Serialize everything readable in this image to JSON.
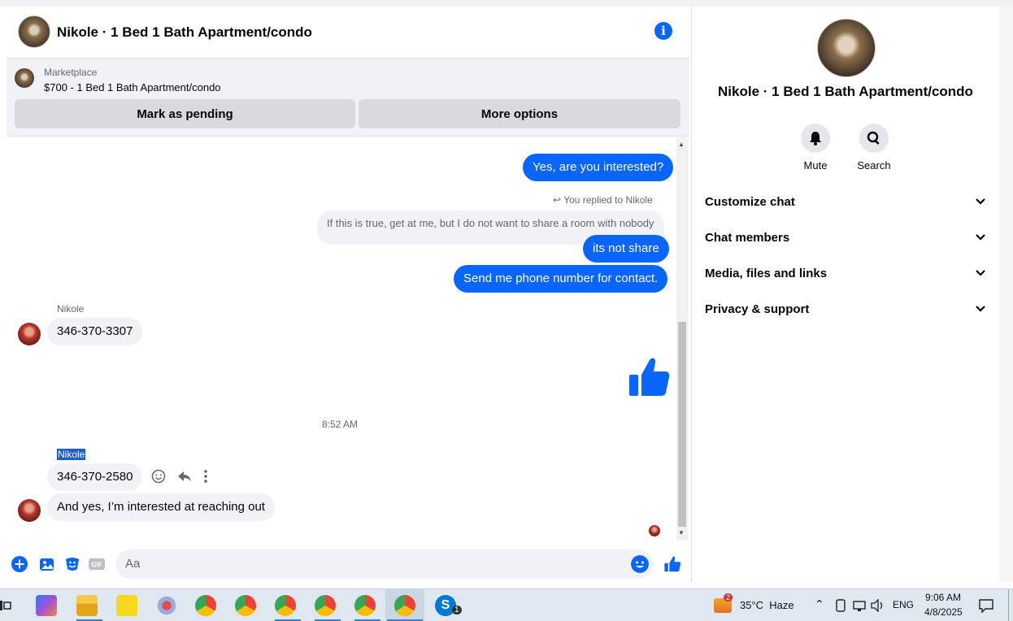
{
  "header": {
    "title": "Nikole · 1 Bed 1 Bath Apartment/condo"
  },
  "marketplace": {
    "label": "Marketplace",
    "item": "$700 - 1 Bed 1 Bath Apartment/condo",
    "mark_pending": "Mark as pending",
    "more_options": "More options"
  },
  "messages": {
    "out1": "Yes, are you interested?",
    "replied_note": "You replied to Nikole",
    "quote": "If this is true, get at me, but I do not want to share a room with nobody",
    "out2": "its not share",
    "out3": "Send me phone number for contact.",
    "sender1": "Nikole",
    "in1": "346-370-3307",
    "timestamp": "8:52 AM",
    "sender2": "Nikole",
    "in2": "346-370-2580",
    "in3": "And yes, I’m interested at reaching out"
  },
  "composer": {
    "placeholder": "Aa"
  },
  "right_panel": {
    "title": "Nikole · 1 Bed 1 Bath Apartment/condo",
    "mute": "Mute",
    "search": "Search",
    "sections": [
      "Customize chat",
      "Chat members",
      "Media, files and links",
      "Privacy & support"
    ]
  },
  "taskbar": {
    "weather_badge": "2",
    "weather": "35°C  Haze",
    "lang": "ENG",
    "time": "9:06 AM",
    "date": "4/8/2025",
    "skype_badge": "1"
  },
  "colors": {
    "accent": "#0866ff",
    "bubble_in": "#f0f2f5"
  }
}
